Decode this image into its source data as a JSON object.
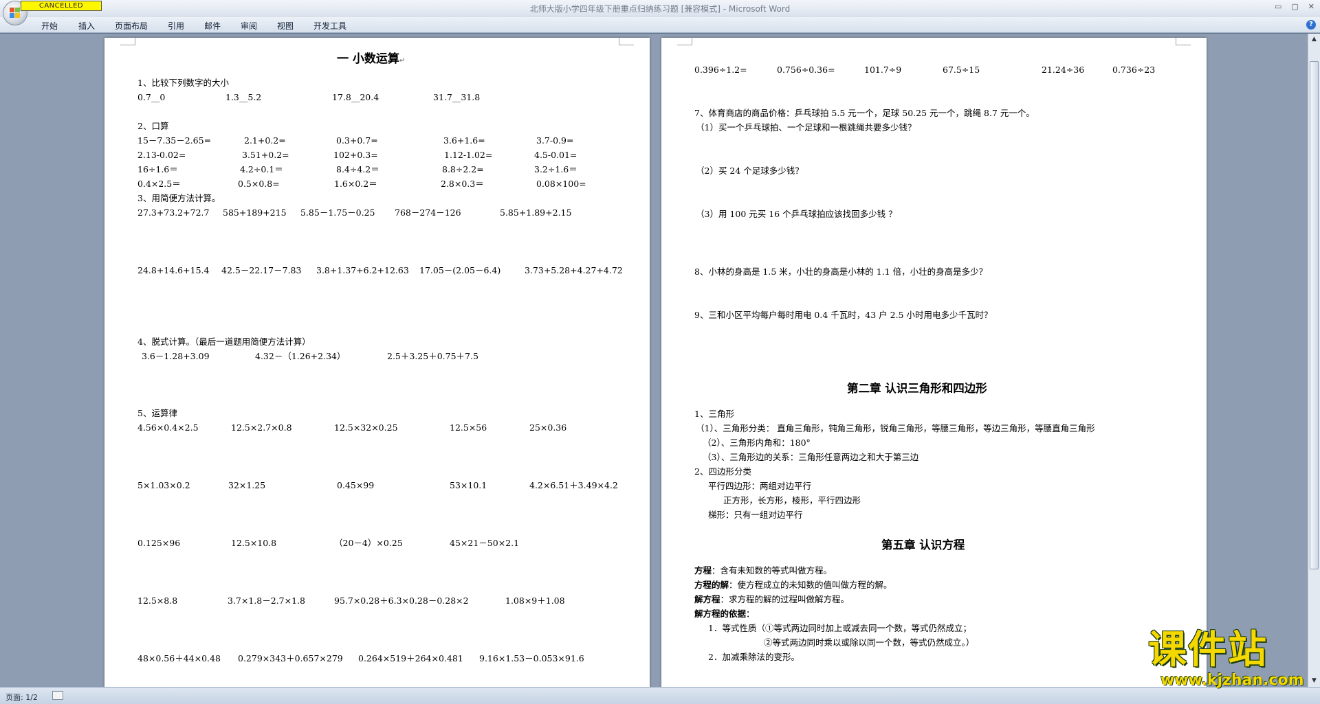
{
  "window": {
    "title": "北师大版小学四年级下册重点归纳练习题 [兼容模式] - Microsoft Word",
    "stamp": "CANCELLED",
    "controls": [
      "▭",
      "▢",
      "✕"
    ]
  },
  "ribbon": {
    "tabs": [
      "开始",
      "插入",
      "页面布局",
      "引用",
      "邮件",
      "审阅",
      "视图",
      "开发工具"
    ],
    "help": "?"
  },
  "status": {
    "pages": "页面: 1/2"
  },
  "watermark": {
    "text": "课件站",
    "url": "www.kjzhan.com"
  },
  "left_page": {
    "title": "一  小数运算",
    "q1": "1、比较下列数字的大小",
    "q1_items": [
      "0.7__0",
      "1.3__5.2",
      "17.8__20.4",
      "31.7__31.8"
    ],
    "q2": "2、口算",
    "q2_rows": [
      [
        "15－7.35－2.65=",
        "2.1+0.2=",
        "0.3+0.7=",
        "3.6+1.6=",
        "3.7-0.9="
      ],
      [
        "2.13-0.02=",
        "3.51+0.2=",
        "102+0.3=",
        "1.12-1.02=",
        "4.5-0.01="
      ],
      [
        "16÷1.6＝",
        "4.2÷0.1＝",
        "8.4÷4.2＝",
        "8.8÷2.2=",
        "3.2÷1.6＝"
      ],
      [
        "0.4×2.5＝",
        "0.5×0.8=",
        "1.6×0.2＝",
        "2.8×0.3＝",
        "0.08×100="
      ]
    ],
    "q3": "3、用简便方法计算。",
    "q3_row1": [
      "27.3+73.2+72.7",
      "585+189+215",
      "5.85－1.75－0.25",
      "768－274－126",
      "5.85+1.89+2.15"
    ],
    "q3_row2": [
      "24.8+14.6+15.4",
      "42.5－22.17－7.83",
      "3.8+1.37+6.2+12.63",
      "17.05－(2.05－6.4)",
      "3.73+5.28+4.27+4.72"
    ],
    "q4": "4、脱式计算。（最后一道题用简便方法计算）",
    "q4_items": [
      "3.6－1.28+3.09",
      "4.32－（1.26+2.34）",
      "2.5＋3.25＋0.75＋7.5"
    ],
    "q5": "5、运算律",
    "q5_rows": [
      [
        "4.56×0.4×2.5",
        "12.5×2.7×0.8",
        "12.5×32×0.25",
        "12.5×56",
        "25×0.36"
      ],
      [
        "5×1.03×0.2",
        "32×1.25",
        "0.45×99",
        "53×10.1",
        "4.2×6.51＋3.49×4.2"
      ],
      [
        "0.125×96",
        "12.5×10.8",
        "（20－4）×0.25",
        "45×21－50×2.1"
      ],
      [
        "12.5×8.8",
        "3.7×1.8－2.7×1.8",
        "95.7×0.28＋6.3×0.28－0.28×2",
        "1.08×9＋1.08"
      ],
      [
        "48×0.56＋44×0.48",
        "0.279×343＋0.657×279",
        "0.264×519＋264×0.481",
        "9.16×1.53－0.053×91.6"
      ]
    ]
  },
  "right_page": {
    "div_row": [
      "0.396÷1.2=",
      "0.756÷0.36=",
      "101.7÷9",
      "67.5÷15",
      "21.24÷36",
      "0.736÷23"
    ],
    "q7": "7、体育商店的商品价格：乒乓球拍 5.5 元一个，足球 50.25 元一个，跳绳 8.7 元一个。",
    "q7_1": "（1）买一个乒乓球拍、一个足球和一根跳绳共要多少钱？",
    "q7_2": "（2）买 24 个足球多少钱？",
    "q7_3": "（3）用 100 元买 16 个乒乓球拍应该找回多少钱 ？",
    "q8": "8、小林的身高是 1.5 米，小壮的身高是小林的 1.1 倍，小壮的身高是多少？",
    "q9": "9、三和小区平均每户每时用电 0.4 千瓦时，43 户 2.5 小时用电多少千瓦时？",
    "ch2_title": "第二章  认识三角形和四边形",
    "ch2_lines": [
      "1、三角形",
      "（1）、三角形分类： 直角三角形，钝角三角形，锐角三角形，等腰三角形，等边三角形，等腰直角三角形",
      "（2）、三角形内角和：180°",
      "（3）、三角形边的关系：三角形任意两边之和大于第三边",
      "2、四边形分类",
      "平行四边形：两组对边平行",
      "正方形，长方形，棱形，平行四边形",
      "梯形：只有一组对边平行"
    ],
    "ch5_title": "第五章  认识方程",
    "ch5_terms": [
      {
        "term": "方程",
        "def": "：含有未知数的等式叫做方程。"
      },
      {
        "term": "方程的解",
        "def": "：使方程成立的未知数的值叫做方程的解。"
      },
      {
        "term": "解方程",
        "def": "：求方程的解的过程叫做解方程。"
      },
      {
        "term": "解方程的依据",
        "def": "："
      }
    ],
    "ch5_list": [
      "1．等式性质（①等式两边同时加上或减去同一个数，等式仍然成立；",
      "②等式两边同时乘以或除以同一个数，等式仍然成立。）",
      "2．加减乘除法的变形。"
    ]
  }
}
